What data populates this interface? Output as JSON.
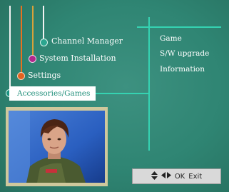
{
  "menu": {
    "items": [
      {
        "label": "Channel Manager",
        "dot_color": "#2ba58f"
      },
      {
        "label": "System Installation",
        "dot_color": "#b0288c"
      },
      {
        "label": "Settings",
        "dot_color": "#e2621f"
      },
      {
        "label": "Accessories/Games",
        "dot_color": "#1a9280"
      }
    ],
    "selected_index": 3
  },
  "submenu": {
    "items": [
      {
        "label": "Game"
      },
      {
        "label": "S/W upgrade"
      },
      {
        "label": "Information"
      }
    ]
  },
  "nav_bar": {
    "updown_icon": "up-down-arrows-icon",
    "leftright_icon": "left-right-arrows-icon",
    "ok_label": "OK",
    "exit_label": "Exit"
  },
  "colors": {
    "background": "#2f8573",
    "line_white": "#f2f2f2",
    "line_orange": "#e9711f",
    "line_gold": "#d8a23a",
    "line_teal": "#35d3b2",
    "selected_text": "#1f8f7a"
  }
}
